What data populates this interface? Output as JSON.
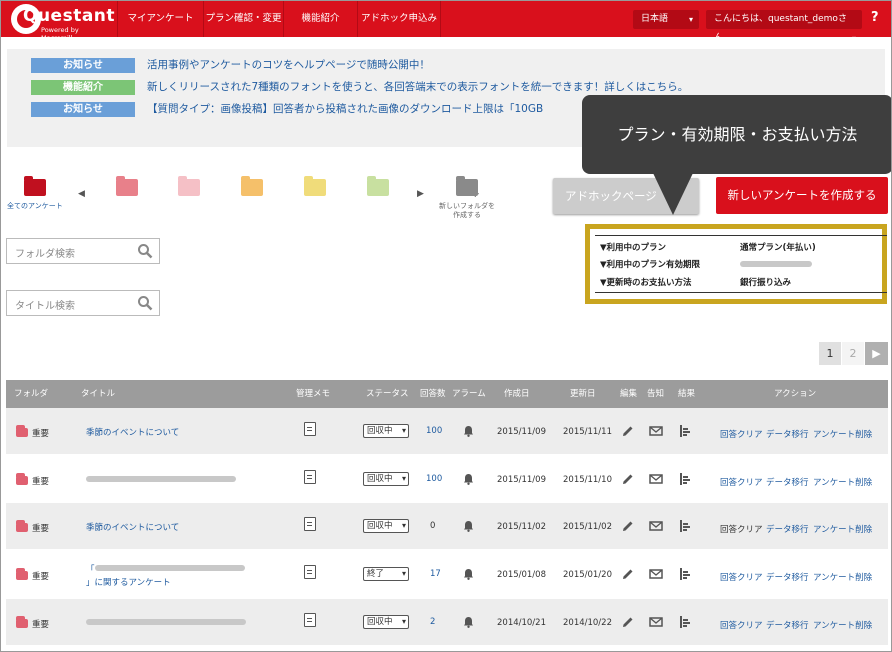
{
  "header": {
    "logo": "Questant",
    "logo_sub": "Powered by Macromill",
    "nav": [
      "マイアンケート",
      "プラン確認・変更",
      "機能紹介",
      "アドホック申込み"
    ],
    "language": "日本語",
    "greeting": "こんにちは、questant_demoさん",
    "help": "?"
  },
  "notices": [
    {
      "tag": "お知らせ",
      "tag_color": "#6a9fd8",
      "text": "活用事例やアンケートのコツをヘルプページで随時公開中！"
    },
    {
      "tag": "機能紹介",
      "tag_color": "#7cc576",
      "text": "新しくリリースされた7種類のフォントを使うと、各回答端末での表示フォントを統一できます！詳しくはこちら。"
    },
    {
      "tag": "お知らせ",
      "tag_color": "#6a9fd8",
      "text": "【質問タイプ：画像投稿】回答者から投稿された画像のダウンロード上限は「10GB"
    }
  ],
  "folders": {
    "all_label": "全てのアンケート",
    "new_label_1": "新しいフォルダを",
    "new_label_2": "作成する",
    "colors": [
      "#c0101f",
      "#e8808a",
      "#f5c0c6",
      "#f5c06a",
      "#f0dc7a",
      "#c8e0a0"
    ]
  },
  "search": {
    "folder_placeholder": "フォルダ検索",
    "title_placeholder": "タイトル検索"
  },
  "buttons": {
    "adhoc": "アドホックページ",
    "create": "新しいアンケートを作成する"
  },
  "tooltip": "プラン・有効期限・お支払い方法",
  "plan": {
    "plan_label": "▼利用中のプラン",
    "plan_value": "通常プラン(年払い)",
    "expiry_label": "▼利用中のプラン有効期限",
    "payment_label": "▼更新時のお支払い方法",
    "payment_value": "銀行振り込み"
  },
  "pager": {
    "current": "1",
    "next": "2",
    "arrow": "▶"
  },
  "table": {
    "headers": [
      "フォルダ",
      "タイトル",
      "管理メモ",
      "ステータス",
      "回答数",
      "アラーム",
      "作成日",
      "更新日",
      "編集",
      "告知",
      "結果",
      "アクション"
    ],
    "actions": [
      "回答クリア",
      "データ移行",
      "アンケート削除"
    ],
    "rows": [
      {
        "folder": "重要",
        "title": "季節のイベントについて",
        "title2": "",
        "blurred": false,
        "status": "回収中",
        "count": "100",
        "created": "2015/11/09",
        "updated": "2015/11/11",
        "clear_link": true
      },
      {
        "folder": "重要",
        "title": "",
        "title2": "",
        "blurred": true,
        "status": "回収中",
        "count": "100",
        "created": "2015/11/09",
        "updated": "2015/11/10",
        "clear_link": true
      },
      {
        "folder": "重要",
        "title": "季節のイベントについて",
        "title2": "",
        "blurred": false,
        "status": "回収中",
        "count": "0",
        "created": "2015/11/02",
        "updated": "2015/11/02",
        "clear_link": false
      },
      {
        "folder": "重要",
        "title": "「",
        "title2": "」に関するアンケート",
        "blurred": true,
        "status": "終了",
        "count": "17",
        "created": "2015/01/08",
        "updated": "2015/01/20",
        "clear_link": true
      },
      {
        "folder": "重要",
        "title": "",
        "title2": "",
        "blurred": true,
        "status": "回収中",
        "count": "2",
        "created": "2014/10/21",
        "updated": "2014/10/22",
        "clear_link": true
      }
    ]
  }
}
